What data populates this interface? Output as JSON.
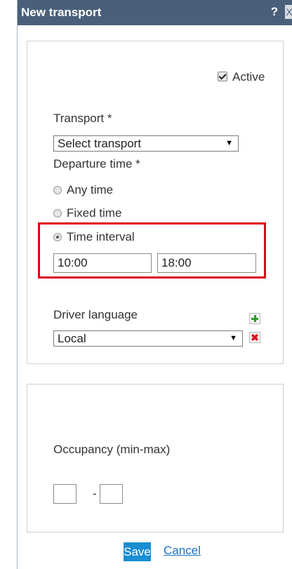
{
  "window": {
    "title": "New transport",
    "help_glyph": "?",
    "close_glyph": "X"
  },
  "form": {
    "active_label": "Active",
    "transport_label": "Transport *",
    "transport_value": "Select transport",
    "departure_label": "Departure time *",
    "options": [
      "Any time",
      "Fixed time",
      "Time interval"
    ],
    "selected_option": "Time interval",
    "time_from": "10:00",
    "time_to": "18:00",
    "driver_language_label": "Driver language",
    "driver_language_value": "Local",
    "occupancy_label": "Occupancy (min-max)",
    "occupancy_separator": "-",
    "occupancy_min": "",
    "occupancy_max": ""
  },
  "actions": {
    "save_label": "Save",
    "cancel_label": "Cancel"
  },
  "colors": {
    "titlebar": "#4a607a",
    "highlight": "#e0001b",
    "save_button": "#1a8ed0",
    "link": "#1a6ec1",
    "add_icon": "#2e9a2e",
    "remove_icon": "#d8141f"
  },
  "icons": {
    "help": "question-mark-icon",
    "close": "close-icon",
    "add": "plus-icon",
    "remove": "x-icon",
    "dropdown": "triangle-down-icon"
  }
}
